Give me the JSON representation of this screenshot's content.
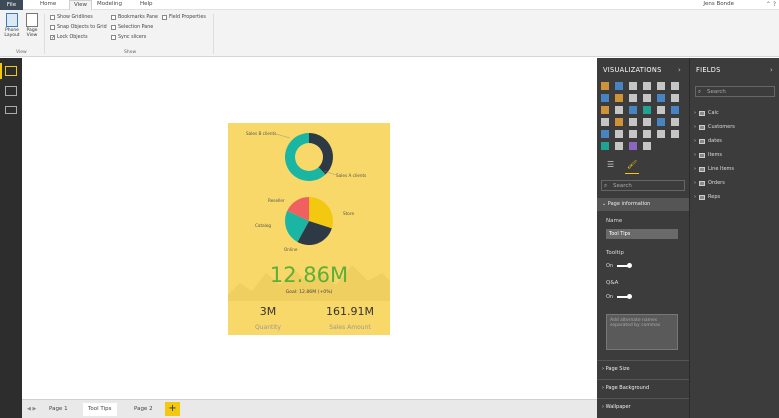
{
  "menu": {
    "tabs": [
      "File",
      "Home",
      "View",
      "Modeling",
      "Help"
    ],
    "user": "Jens Bonde"
  },
  "ribbon": {
    "phone_layout": "Phone Layout",
    "page_view": "Page View",
    "view_group": "View",
    "show_group": "Show",
    "checks": [
      {
        "label": "Show Gridlines",
        "checked": false
      },
      {
        "label": "Snap Objects to Grid",
        "checked": false
      },
      {
        "label": "Lock Objects",
        "checked": true
      },
      {
        "label": "Bookmarks Pane",
        "checked": false
      },
      {
        "label": "Selection Pane",
        "checked": false
      },
      {
        "label": "Sync slicers",
        "checked": false
      },
      {
        "label": "Field Properties",
        "checked": false
      }
    ]
  },
  "report": {
    "donut": {
      "label_top": "Sales B clients",
      "label_right": "Sales A clients",
      "values": [
        38,
        62
      ],
      "colors": [
        "#2d3a45",
        "#1ab5a3"
      ]
    },
    "pie": {
      "slices": [
        {
          "label": "Store",
          "value": 30,
          "color": "#f2c811"
        },
        {
          "label": "Online",
          "value": 28,
          "color": "#2d3a45"
        },
        {
          "label": "Catalog",
          "value": 24,
          "color": "#1ab5a3"
        },
        {
          "label": "Reseller",
          "value": 18,
          "color": "#f06060"
        }
      ]
    },
    "kpi_value": "12.86M",
    "kpi_goal": "Goal: 12.86M (+0%)",
    "card1_value": "3M",
    "card1_label": "Quantity",
    "card2_value": "161.91M",
    "card2_label": "Sales Amount"
  },
  "pages": {
    "tabs": [
      "Page 1",
      "Tool Tips",
      "Page 2"
    ],
    "active": "Tool Tips",
    "add": "+"
  },
  "viz_pane": {
    "title": "VISUALIZATIONS",
    "search_placeholder": "Search",
    "sections": {
      "page_info": "Page information",
      "page_size": "Page Size",
      "page_background": "Page Background",
      "wallpaper": "Wallpaper"
    },
    "name_label": "Name",
    "name_value": "Tool Tips",
    "tooltip_label": "Tooltip",
    "tooltip_state": "On",
    "qna_label": "Q&A",
    "qna_state": "On",
    "alt_placeholder": "Add alternate names separated by commas"
  },
  "fields_pane": {
    "title": "FIELDS",
    "search_placeholder": "Search",
    "tables": [
      "Calc",
      "Customers",
      "dates",
      "Items",
      "Line Items",
      "Orders",
      "Reps"
    ]
  }
}
